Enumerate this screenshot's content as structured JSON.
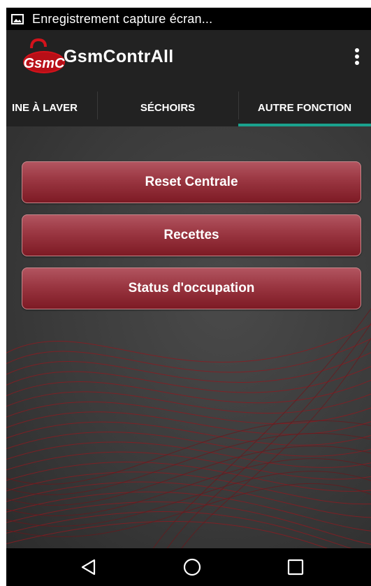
{
  "status_bar": {
    "notification_icon": "screenshot-notification-icon",
    "text": "Enregistrement capture écran..."
  },
  "action_bar": {
    "logo_text": "GsmC",
    "title": "GsmContrAll",
    "overflow_icon": "more-vert-icon"
  },
  "tabs": [
    {
      "label": "INE À LAVER",
      "selected": false
    },
    {
      "label": "SÉCHOIRS",
      "selected": false
    },
    {
      "label": "AUTRE FONCTION",
      "selected": true
    }
  ],
  "buttons": [
    {
      "label": "Reset Centrale"
    },
    {
      "label": "Recettes"
    },
    {
      "label": "Status d'occupation"
    }
  ],
  "nav_bar": {
    "back_icon": "back-triangle-icon",
    "home_icon": "home-circle-icon",
    "recents_icon": "recents-square-icon"
  },
  "colors": {
    "accent": "#1aa28e",
    "button_top": "#b25560",
    "button_bottom": "#7d1a24",
    "wave_lines": "#8a1c22",
    "logo_red": "#d3121b"
  }
}
